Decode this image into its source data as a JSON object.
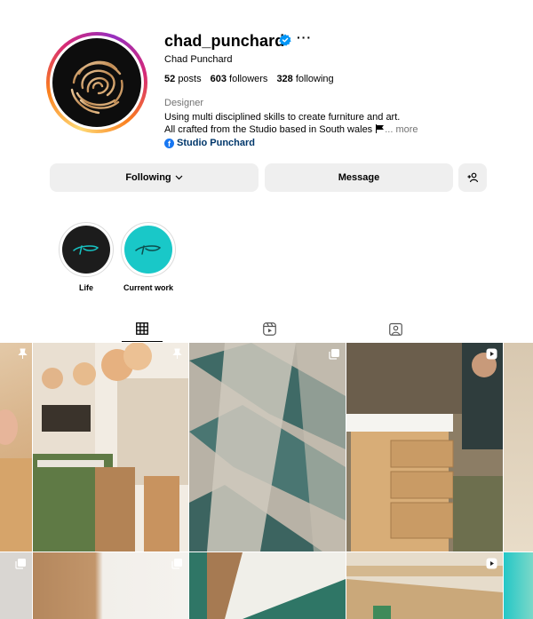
{
  "profile": {
    "username": "chad_punchard",
    "full_name": "Chad Punchard",
    "category": "Designer",
    "bio_line1": "Using multi disciplined skills to create furniture and art.",
    "bio_line2": "All crafted from the Studio based in South wales",
    "bio_more": "... more",
    "link_text": "Studio Punchard",
    "more_options": "···"
  },
  "stats": {
    "posts_count": "52",
    "posts_label": "posts",
    "followers_count": "603",
    "followers_label": "followers",
    "following_count": "328",
    "following_label": "following"
  },
  "actions": {
    "following_label": "Following",
    "message_label": "Message"
  },
  "highlights": [
    {
      "label": "Life",
      "color": "#1c1c1c"
    },
    {
      "label": "Current work",
      "color": "#19c8c8"
    }
  ],
  "tabs": [
    "posts-grid-icon",
    "reels-icon",
    "tagged-icon"
  ],
  "colors": {
    "verified": "#0095f6",
    "link": "#00376b",
    "button_bg": "#efefef",
    "secondary_text": "#737373"
  }
}
